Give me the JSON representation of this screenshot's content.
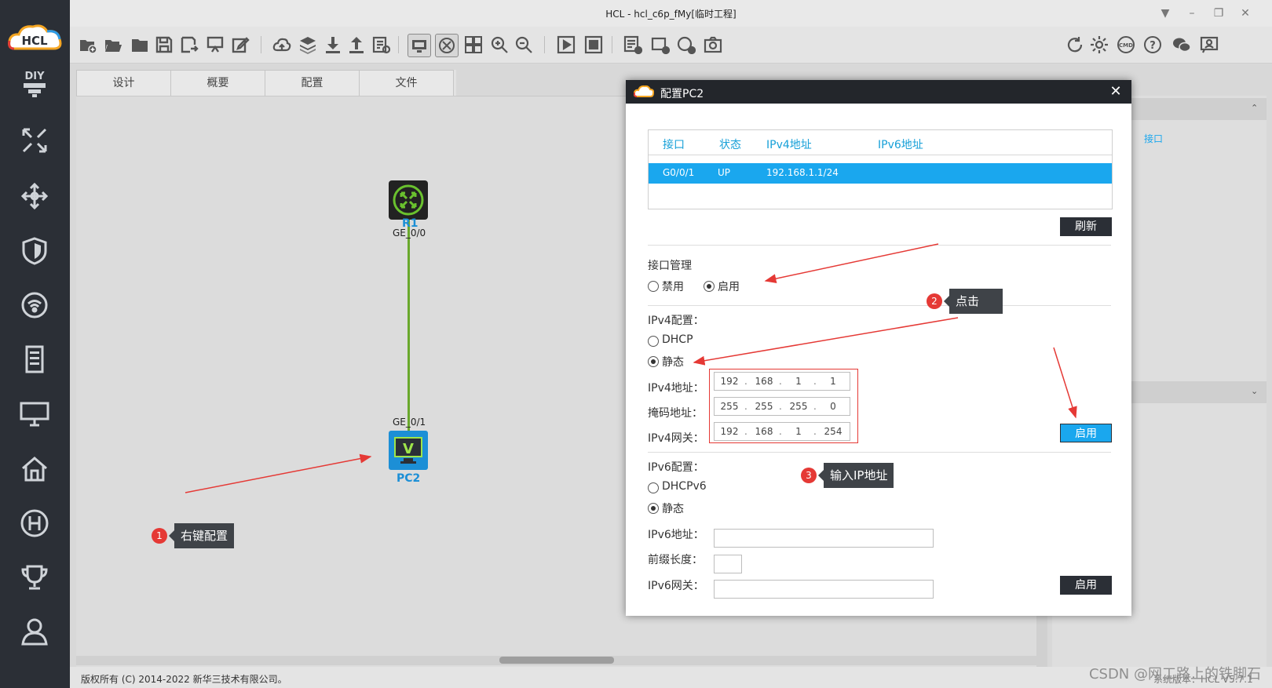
{
  "window": {
    "title": "HCL - hcl_c6p_fMy[临时工程]",
    "logo_text": "HCL"
  },
  "tabs": [
    "设计",
    "概要",
    "配置",
    "文件"
  ],
  "topology": {
    "router": {
      "name": "R1",
      "port": "GE_0/0"
    },
    "pc": {
      "name": "PC2",
      "port": "GE_0/1"
    }
  },
  "dialog": {
    "title": "配置PC2",
    "close": "✕",
    "table": {
      "headers": [
        "接口",
        "状态",
        "IPv4地址",
        "IPv6地址"
      ],
      "rows": [
        {
          "iface": "G0/0/1",
          "status": "UP",
          "ipv4": "192.168.1.1/24",
          "ipv6": ""
        }
      ]
    },
    "refresh_label": "刷新",
    "iface_mgmt": {
      "label": "接口管理",
      "disable": "禁用",
      "enable": "启用",
      "selected": "启用"
    },
    "ipv4": {
      "section_label": "IPv4配置：",
      "dhcp": "DHCP",
      "static": "静态",
      "selected": "静态",
      "addr_label": "IPv4地址：",
      "mask_label": "掩码地址：",
      "gw_label": "IPv4网关：",
      "addr": [
        "192",
        "168",
        "1",
        "1"
      ],
      "mask": [
        "255",
        "255",
        "255",
        "0"
      ],
      "gw": [
        "192",
        "168",
        "1",
        "254"
      ],
      "apply_label": "启用"
    },
    "ipv6": {
      "section_label": "IPv6配置：",
      "dhcp": "DHCPv6",
      "static": "静态",
      "selected": "静态",
      "addr_label": "IPv6地址：",
      "prefix_label": "前缀长度：",
      "gw_label": "IPv6网关：",
      "addr": "",
      "prefix": "",
      "gw": "",
      "apply_label": "启用"
    }
  },
  "right_panel": {
    "item": "接口"
  },
  "callouts": [
    {
      "num": "1",
      "text": "右键配置"
    },
    {
      "num": "2",
      "text": "点击"
    },
    {
      "num": "3",
      "text": "输入IP地址"
    }
  ],
  "statusbar": {
    "copyright": "版权所有 (C) 2014-2022 新华三技术有限公司。",
    "version": "系统版本：HCL V5.7.1"
  },
  "watermark": "CSDN @网工路上的铁脚石",
  "colors": {
    "accent": "#1aa7ee",
    "sidebar": "#2b2f36",
    "arrow": "#e53935"
  }
}
